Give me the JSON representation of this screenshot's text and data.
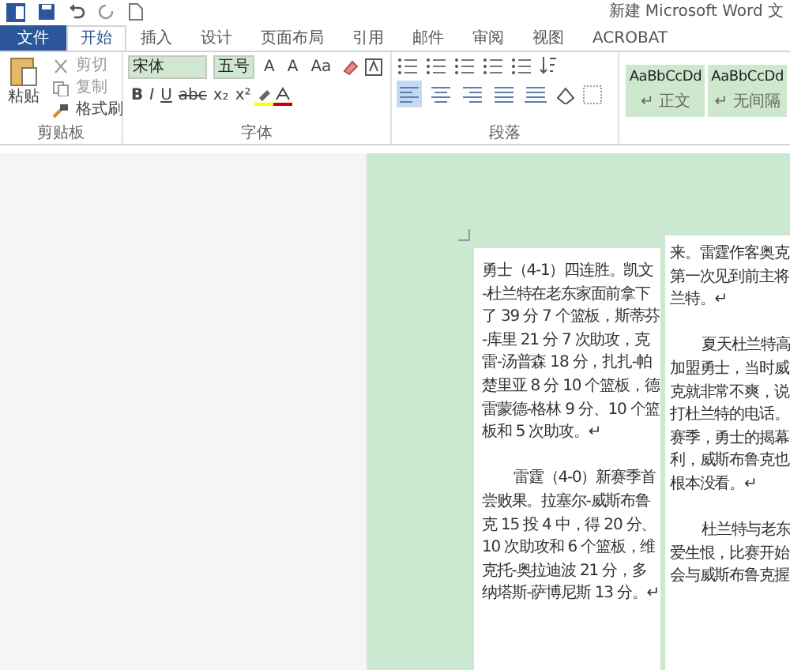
{
  "title_bar": {
    "title": "新建 Microsoft Word 文"
  },
  "tabs": [
    {
      "label": "文件",
      "kind": "file",
      "selected": false
    },
    {
      "label": "开始",
      "kind": "tab",
      "selected": true
    },
    {
      "label": "插入",
      "kind": "tab",
      "selected": false
    },
    {
      "label": "设计",
      "kind": "tab",
      "selected": false
    },
    {
      "label": "页面布局",
      "kind": "tab",
      "selected": false
    },
    {
      "label": "引用",
      "kind": "tab",
      "selected": false
    },
    {
      "label": "邮件",
      "kind": "tab",
      "selected": false
    },
    {
      "label": "审阅",
      "kind": "tab",
      "selected": false
    },
    {
      "label": "视图",
      "kind": "tab",
      "selected": false
    },
    {
      "label": "ACROBAT",
      "kind": "tab",
      "selected": false
    }
  ],
  "clipboard": {
    "paste": "粘贴",
    "items": [
      "剪切",
      "复制",
      "格式刷"
    ],
    "label": "剪贴板"
  },
  "font": {
    "name": "宋体",
    "size": "五号",
    "row1": [
      "A",
      "A",
      "Aa"
    ],
    "row2": [
      "B",
      "I",
      "U",
      "abc",
      "x₂",
      "x²"
    ],
    "label": "字体"
  },
  "paragraph": {
    "align": [
      {
        "kind": "left",
        "selected": true
      },
      {
        "kind": "center",
        "selected": false
      },
      {
        "kind": "right",
        "selected": false
      },
      {
        "kind": "justify",
        "selected": false
      },
      {
        "kind": "distributed",
        "selected": false
      }
    ],
    "label": "段落"
  },
  "styles": [
    {
      "sample": "AaBbCcDd",
      "name": "↵ 正文"
    },
    {
      "sample": "AaBbCcDd",
      "name": "↵ 无间隔"
    }
  ],
  "pages": [
    {
      "paragraphs": [
        {
          "indent": false,
          "lines": [
            "勇士（4-1）四连胜。凯文",
            "-杜兰特在老东家面前拿下",
            "了 39 分 7 个篮板，斯蒂芬",
            "-库里 21 分 7 次助攻，克",
            "雷-汤普森 18 分，扎扎-帕",
            "楚里亚 8 分 10 个篮板，德",
            "雷蒙德-格林 9 分、10 个篮",
            "板和 5 次助攻。↵"
          ]
        },
        {
          "indent": true,
          "lines": [
            "雷霆（4-0）新赛季首",
            "尝败果。拉塞尔-威斯布鲁",
            "克 15 投 4 中，得 20 分、",
            "10 次助攻和 6 个篮板，维",
            "克托-奥拉迪波 21 分，多",
            "纳塔斯-萨博尼斯 13 分。↵"
          ]
        }
      ]
    },
    {
      "paragraphs": [
        {
          "indent": false,
          "lines": [
            "来。雷霆作客奥克",
            "第一次见到前主将",
            "兰特。↵"
          ]
        },
        {
          "indent": true,
          "lines": [
            "夏天杜兰特高",
            "加盟勇士，当时威",
            "克就非常不爽，说",
            "打杜兰特的电话。",
            "赛季，勇士的揭幕",
            "利，威斯布鲁克也",
            "根本没看。↵"
          ]
        },
        {
          "indent": true,
          "lines": [
            "杜兰特与老东",
            "爱生恨，比赛开始",
            "会与威斯布鲁克握"
          ]
        }
      ]
    }
  ]
}
